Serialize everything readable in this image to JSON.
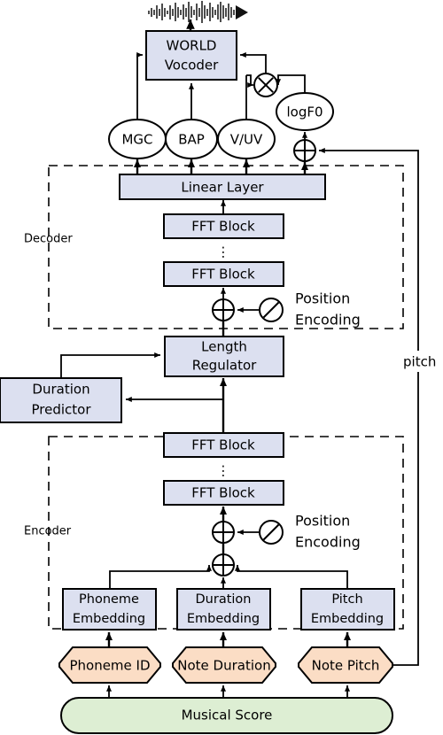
{
  "figure": {
    "type": "architecture-diagram",
    "title": "Singing voice synthesis acoustic model architecture",
    "colors": {
      "block_fill": "#dce0f0",
      "input_fill": "#fbddc5",
      "score_fill": "#ddeed3",
      "stroke": "#000000",
      "background": "#ffffff"
    }
  },
  "output": {
    "waveform_label": "waveform"
  },
  "vocoder": {
    "line1": "WORLD",
    "line2": "Vocoder"
  },
  "features": [
    {
      "id": "mgc",
      "label": "MGC",
      "shape": "ellipse"
    },
    {
      "id": "bap",
      "label": "BAP",
      "shape": "ellipse"
    },
    {
      "id": "vuv",
      "label": "V/UV",
      "shape": "ellipse"
    },
    {
      "id": "logf0",
      "label": "logF0",
      "shape": "ellipse"
    }
  ],
  "operators": {
    "multiply": "⊗",
    "add": "⊕"
  },
  "decoder": {
    "group_label": "Decoder",
    "linear_layer": "Linear Layer",
    "fft_top": "FFT Block",
    "fft_bottom": "FFT Block",
    "ellipsis": "⋮",
    "position_encoding_line1": "Position",
    "position_encoding_line2": "Encoding"
  },
  "middle": {
    "length_regulator_line1": "Length",
    "length_regulator_line2": "Regulator",
    "duration_predictor_line1": "Duration",
    "duration_predictor_line2": "Predictor"
  },
  "encoder": {
    "group_label": "Encoder",
    "fft_top": "FFT Block",
    "fft_bottom": "FFT Block",
    "ellipsis": "⋮",
    "position_encoding_line1": "Position",
    "position_encoding_line2": "Encoding"
  },
  "embeddings": [
    {
      "id": "phoneme",
      "line1": "Phoneme",
      "line2": "Embedding"
    },
    {
      "id": "duration",
      "line1": "Duration",
      "line2": "Embedding"
    },
    {
      "id": "pitch",
      "line1": "Pitch",
      "line2": "Embedding"
    }
  ],
  "inputs": [
    {
      "id": "phoneme-id",
      "label": "Phoneme ID"
    },
    {
      "id": "note-duration",
      "label": "Note Duration"
    },
    {
      "id": "note-pitch",
      "label": "Note Pitch"
    }
  ],
  "score": {
    "label": "Musical Score"
  },
  "annotations": {
    "pitch_path": "pitch"
  }
}
